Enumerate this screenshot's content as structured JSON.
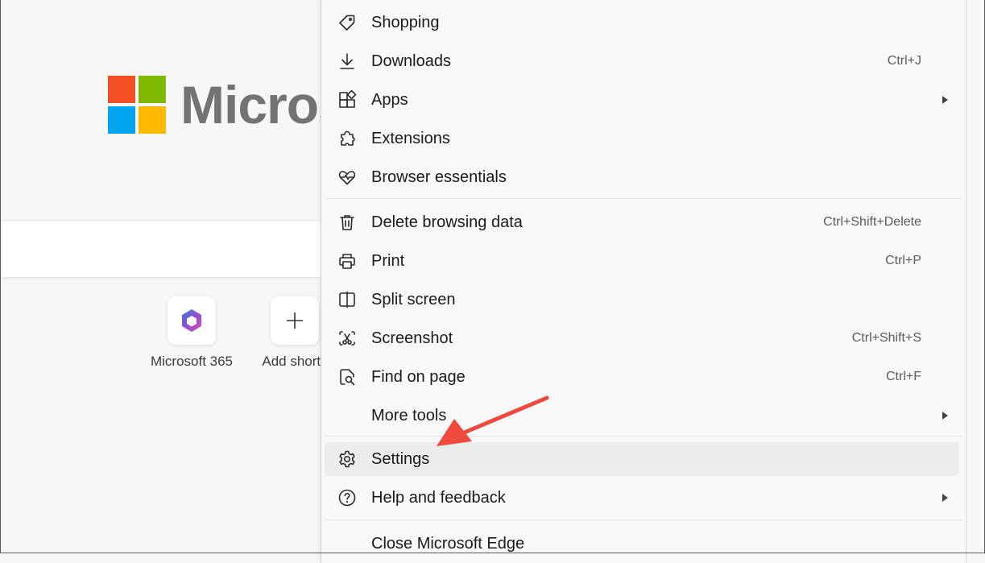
{
  "newtab": {
    "logo_text": "Micros",
    "tiles": [
      {
        "label": "Microsoft 365",
        "icon": "microsoft-365-icon"
      },
      {
        "label": "Add shortc",
        "icon": "plus-icon"
      }
    ]
  },
  "menu": {
    "items": [
      {
        "label": "Shopping",
        "shortcut": "",
        "icon": "tag-icon"
      },
      {
        "label": "Downloads",
        "shortcut": "Ctrl+J",
        "icon": "download-icon"
      },
      {
        "label": "Apps",
        "shortcut": "",
        "icon": "apps-icon",
        "submenu": true
      },
      {
        "label": "Extensions",
        "shortcut": "",
        "icon": "puzzle-icon"
      },
      {
        "label": "Browser essentials",
        "shortcut": "",
        "icon": "heart-pulse-icon"
      },
      {
        "label": "Delete browsing data",
        "shortcut": "Ctrl+Shift+Delete",
        "icon": "trash-icon"
      },
      {
        "label": "Print",
        "shortcut": "Ctrl+P",
        "icon": "printer-icon"
      },
      {
        "label": "Split screen",
        "shortcut": "",
        "icon": "split-screen-icon"
      },
      {
        "label": "Screenshot",
        "shortcut": "Ctrl+Shift+S",
        "icon": "scissors-icon"
      },
      {
        "label": "Find on page",
        "shortcut": "Ctrl+F",
        "icon": "find-icon"
      },
      {
        "label": "More tools",
        "shortcut": "",
        "icon": "",
        "submenu": true
      },
      {
        "label": "Settings",
        "shortcut": "",
        "icon": "gear-icon",
        "highlighted": true
      },
      {
        "label": "Help and feedback",
        "shortcut": "",
        "icon": "help-icon",
        "submenu": true
      },
      {
        "label": "Close Microsoft Edge",
        "shortcut": "",
        "icon": ""
      }
    ]
  },
  "colors": {
    "annotation_arrow": "#f04a3e",
    "logo_red": "#f25022",
    "logo_green": "#7fba00",
    "logo_blue": "#00a4ef",
    "logo_yellow": "#ffb900"
  }
}
